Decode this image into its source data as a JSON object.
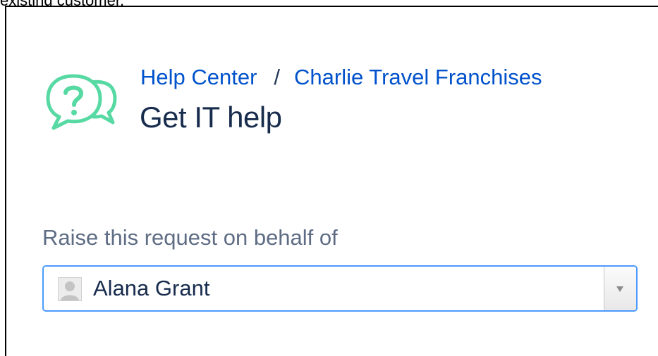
{
  "caption": "existing customer.",
  "breadcrumb": {
    "items": [
      "Help Center",
      "Charlie Travel Franchises"
    ],
    "separator": "/"
  },
  "page": {
    "title": "Get IT help"
  },
  "request_form": {
    "on_behalf_label": "Raise this request on behalf of",
    "selected_customer": "Alana Grant"
  },
  "icons": {
    "logo": "chat-bubbles-question-icon",
    "avatar": "default-user-avatar",
    "dropdown": "chevron-down-icon"
  },
  "colors": {
    "link": "#0052cc",
    "title": "#172b4d",
    "label": "#5e6c84",
    "logo": "#57d9a3",
    "focus_border": "#4c9aff"
  }
}
